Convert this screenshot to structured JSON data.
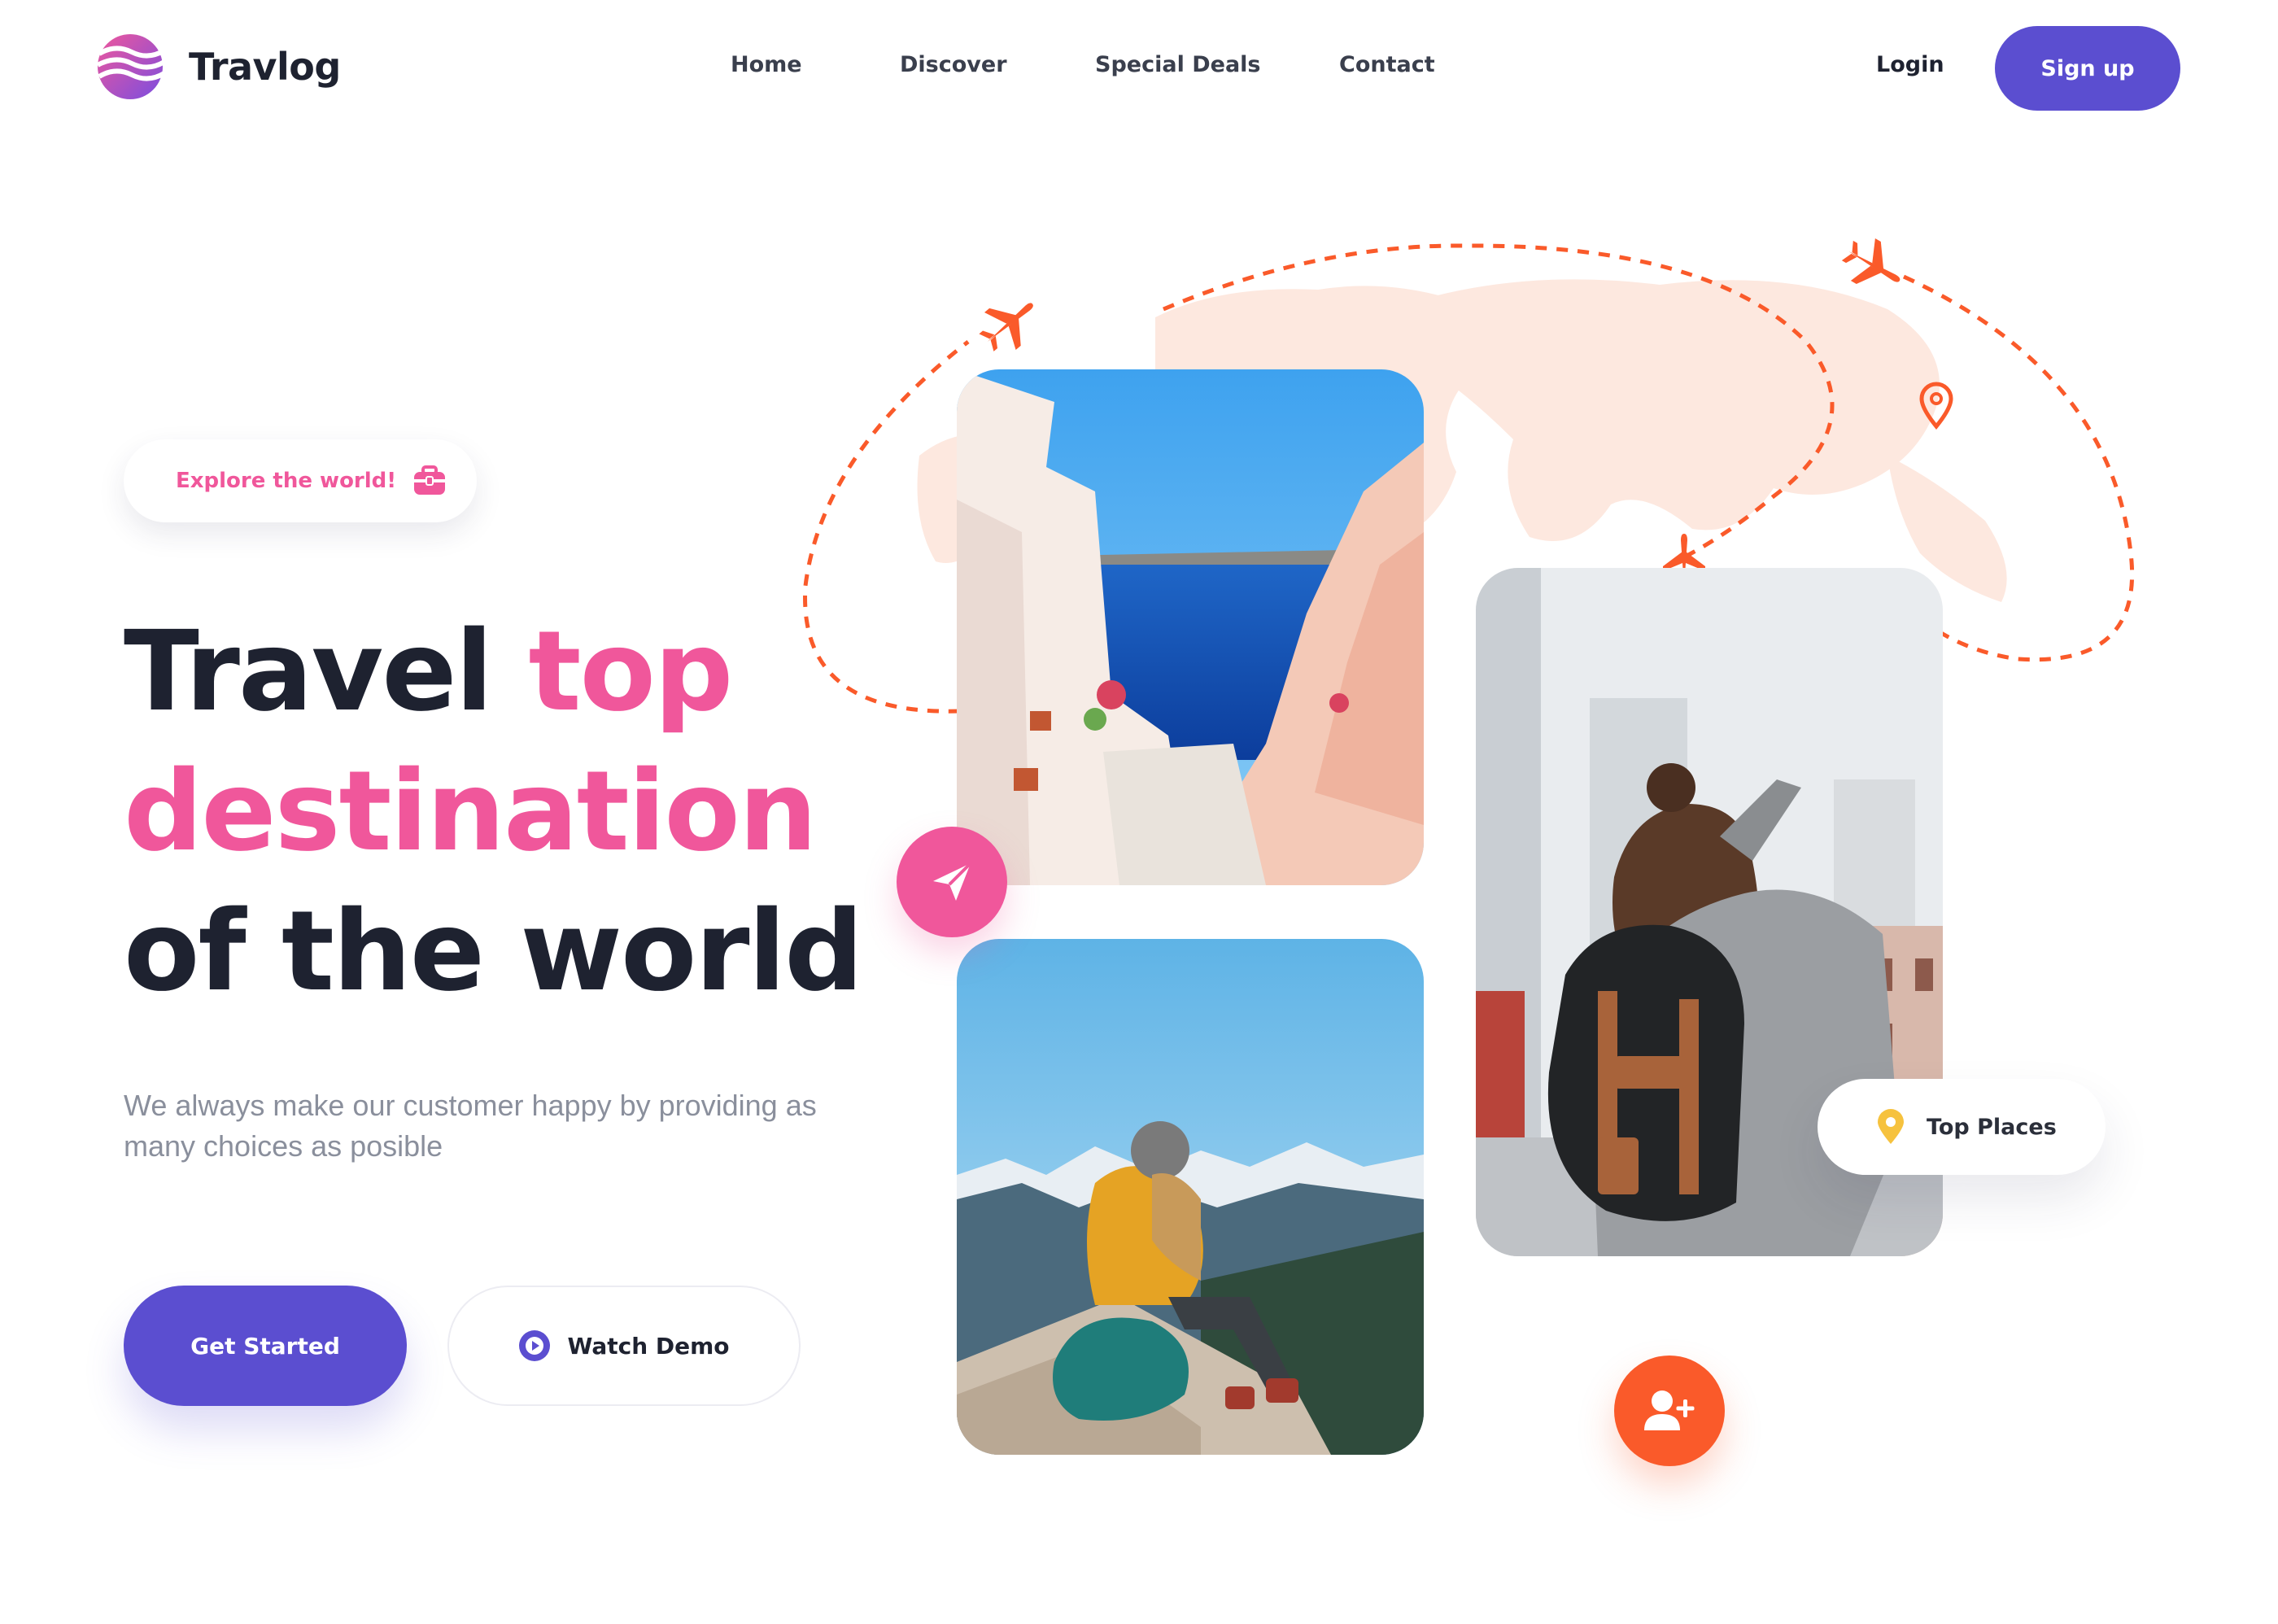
{
  "brand": {
    "name": "Travlog"
  },
  "nav": {
    "items": [
      {
        "label": "Home"
      },
      {
        "label": "Discover"
      },
      {
        "label": "Special Deals"
      },
      {
        "label": "Contact"
      }
    ],
    "login_label": "Login",
    "signup_label": "Sign up"
  },
  "hero": {
    "badge": {
      "label": "Explore the world!",
      "icon": "briefcase-icon"
    },
    "headline": {
      "part1": "Travel ",
      "part2": "top",
      "part3": "destination",
      "part4": "of the world"
    },
    "subtext": "We always make our customer happy by providing as many choices as posible",
    "primary_button": "Get Started",
    "secondary_button": "Watch Demo"
  },
  "illustration": {
    "photos": [
      {
        "subject": "Santorini coastal stairway"
      },
      {
        "subject": "Hiker writing on mountain"
      },
      {
        "subject": "Traveler photographing city"
      }
    ],
    "floating_card": {
      "label": "Top Places",
      "icon": "location-pin-icon"
    },
    "icons": [
      "paper-plane-icon",
      "add-user-icon",
      "airplane-icon",
      "map-pin-icon"
    ]
  },
  "colors": {
    "primary": "#5b4ed0",
    "accent_pink": "#f0579b",
    "accent_orange": "#fa5a2a",
    "text_dark": "#1e2230",
    "text_muted": "#8a8f9c"
  }
}
